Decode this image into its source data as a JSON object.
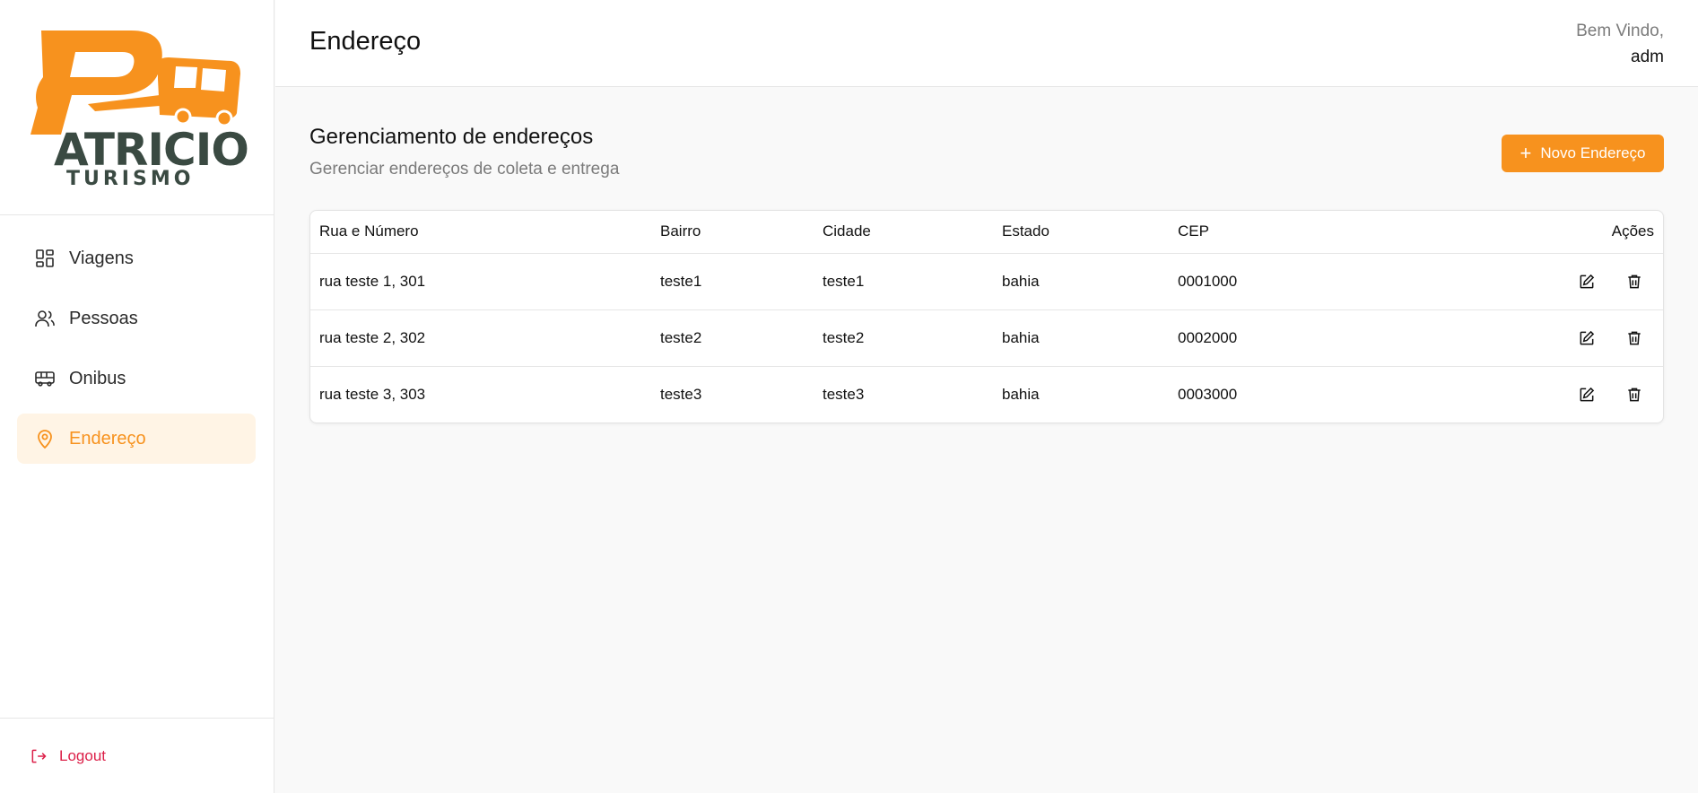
{
  "brand": {
    "logo_text_top": "ATRICIO",
    "logo_text_bottom": "TURISMO",
    "colors": {
      "orange": "#f7921e",
      "dark": "#3a4a42"
    }
  },
  "sidebar": {
    "items": [
      {
        "label": "Viagens",
        "icon": "dashboard-icon",
        "active": false
      },
      {
        "label": "Pessoas",
        "icon": "users-icon",
        "active": false
      },
      {
        "label": "Onibus",
        "icon": "bus-icon",
        "active": false
      },
      {
        "label": "Endereço",
        "icon": "map-pin-icon",
        "active": true
      }
    ],
    "logout_label": "Logout"
  },
  "header": {
    "title": "Endereço",
    "welcome": "Bem Vindo,",
    "user": "adm"
  },
  "main": {
    "section_title": "Gerenciamento de endereços",
    "section_subtitle": "Gerenciar endereços de coleta e entrega",
    "new_button": "Novo Endereço",
    "columns": [
      "Rua e Número",
      "Bairro",
      "Cidade",
      "Estado",
      "CEP",
      "Ações"
    ],
    "rows": [
      {
        "rua": "rua teste 1, 301",
        "bairro": "teste1",
        "cidade": "teste1",
        "estado": "bahia",
        "cep": "0001000"
      },
      {
        "rua": "rua teste 2, 302",
        "bairro": "teste2",
        "cidade": "teste2",
        "estado": "bahia",
        "cep": "0002000"
      },
      {
        "rua": "rua teste 3, 303",
        "bairro": "teste3",
        "cidade": "teste3",
        "estado": "bahia",
        "cep": "0003000"
      }
    ]
  },
  "colors": {
    "accent": "#f7921e",
    "active_bg": "#fff4e5",
    "logout": "#dc1f48"
  }
}
